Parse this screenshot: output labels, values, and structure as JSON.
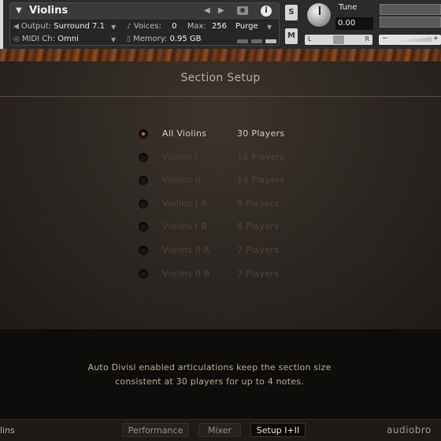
{
  "header": {
    "instrument_name": "Violins",
    "output_label": "Output:",
    "output_value": "Surround 7.1",
    "voices_label": "Voices:",
    "voices_value": "0",
    "max_label": "Max:",
    "max_value": "256",
    "purge_label": "Purge",
    "midi_label": "MIDI Ch:",
    "midi_value": "Omni",
    "memory_label": "Memory:",
    "memory_value": "0.95 GB",
    "solo_label": "S",
    "mute_label": "M",
    "tune_label": "Tune",
    "tune_value": "0.00",
    "pan_left": "L",
    "pan_right": "R",
    "vol_minus": "−",
    "vol_plus": "+"
  },
  "section": {
    "title": "Section Setup",
    "options": [
      {
        "name": "All Violins",
        "players": "30 Players",
        "selected": true
      },
      {
        "name": "Violins I",
        "players": "16 Players",
        "selected": false
      },
      {
        "name": "Violins II",
        "players": "14 Players",
        "selected": false
      },
      {
        "name": "Violins I A",
        "players": "8 Players",
        "selected": false
      },
      {
        "name": "Violins I B",
        "players": "8 Players",
        "selected": false
      },
      {
        "name": "Violins II A",
        "players": "7 Players",
        "selected": false
      },
      {
        "name": "Violins II B",
        "players": "7 Players",
        "selected": false
      }
    ]
  },
  "info": {
    "line1": "Auto Divisi enabled articulations keep the section size",
    "line2": "consistent at 30 players for up to 4 notes."
  },
  "footer": {
    "left_text": "lins",
    "tabs": [
      "Performance",
      "Mixer",
      "Setup I+II"
    ],
    "selected_tab": "Setup I+II",
    "brand": "audiobro"
  },
  "colors": {
    "accent_radio": "#e0583a",
    "active_text": "#d6cdbf",
    "inactive_text": "#4d453c"
  }
}
